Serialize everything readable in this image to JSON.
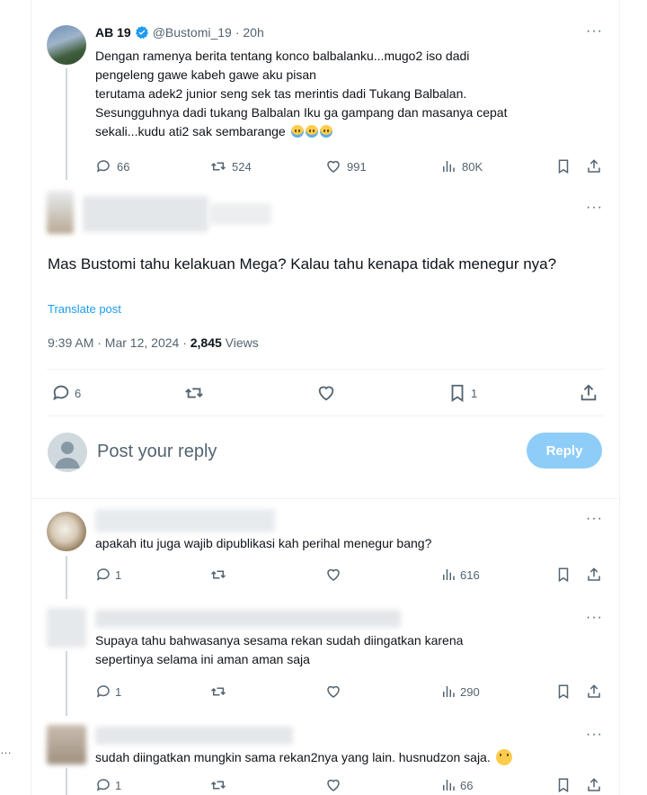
{
  "top_tweet": {
    "name": "AB 19",
    "handle": "@Bustomi_19",
    "time": "· 20h",
    "lines": [
      "Dengan ramenya berita tentang konco balbalanku...mugo2 iso dadi",
      "pengeleng gawe kabeh gawe aku pisan",
      "terutama adek2 junior seng sek tas merintis dadi Tukang Balbalan.",
      "Sesungguhnya dadi tukang Balbalan Iku ga gampang dan masanya cepat",
      "sekali...kudu ati2 sak sembarange"
    ],
    "stats": {
      "replies": "66",
      "reposts": "524",
      "likes": "991",
      "views": "80K"
    }
  },
  "main_tweet": {
    "text": "Mas Bustomi tahu kelakuan Mega? Kalau tahu kenapa tidak menegur nya?",
    "translate": "Translate post",
    "time_date": "9:39 AM · Mar 12, 2024 · ",
    "views_count": "2,845",
    "views_label": " Views",
    "replies": "6",
    "bookmarks": "1"
  },
  "composer": {
    "placeholder": "Post your reply",
    "button": "Reply"
  },
  "replies": [
    {
      "text": "apakah itu juga wajib dipublikasi kah perihal menegur bang?",
      "replies": "1",
      "views": "616"
    },
    {
      "text_l1": "Supaya tahu bahwasanya sesama rekan sudah diingatkan karena",
      "text_l2": "sepertinya selama ini aman aman saja",
      "replies": "1",
      "views": "290"
    },
    {
      "text": "sudah diingatkan mungkin sama rekan2nya yang lain. husnudzon saja.",
      "replies": "1",
      "views": "66"
    }
  ],
  "colors": {
    "accent": "#1d9bf0",
    "reply_button": "#8ecdf8",
    "muted": "#536471"
  }
}
